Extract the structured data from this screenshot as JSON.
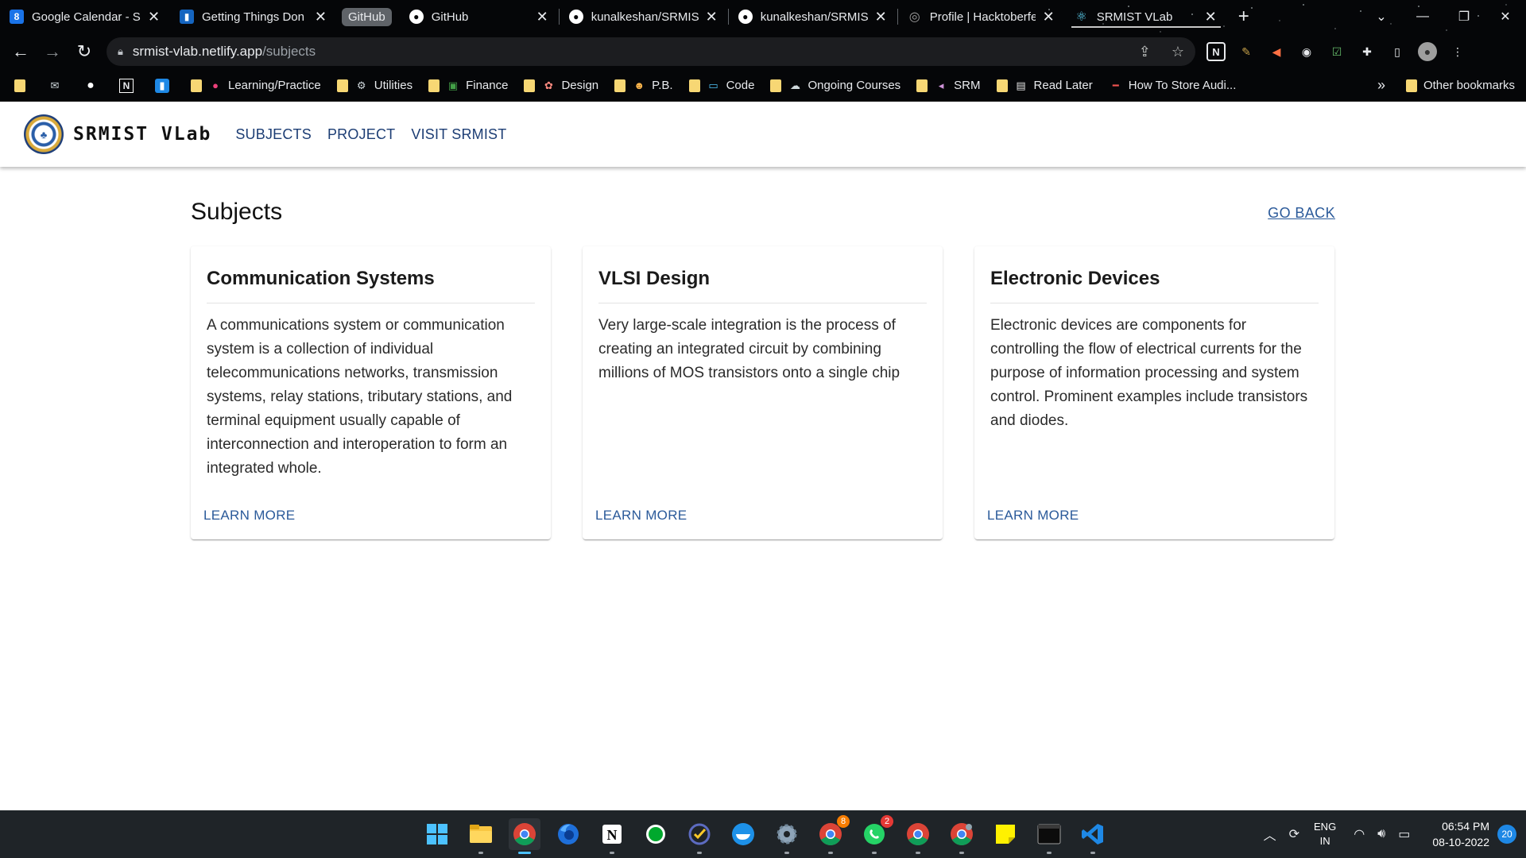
{
  "browser": {
    "tabs": [
      {
        "title": "Google Calendar - S",
        "favicon": "calendar-icon",
        "color": "#1a73e8",
        "glyph": "8"
      },
      {
        "title": "Getting Things Don",
        "favicon": "trello-icon",
        "color": "#1565c0",
        "glyph": "▮▮"
      },
      {
        "title": "GitHub",
        "favicon": "github-icon",
        "color": "#ffffff",
        "glyph": "●"
      },
      {
        "title": "kunalkeshan/SRMIS",
        "favicon": "github-icon",
        "color": "#ffffff",
        "glyph": "●"
      },
      {
        "title": "kunalkeshan/SRMIS",
        "favicon": "github-icon",
        "color": "#ffffff",
        "glyph": "●"
      },
      {
        "title": "Profile | Hacktoberfe",
        "favicon": "hacktoberfest-icon",
        "color": "#9e9e9e",
        "glyph": "◎"
      },
      {
        "title": "SRMIST VLab",
        "favicon": "react-icon",
        "color": "#61dafb",
        "glyph": "⚛"
      }
    ],
    "tab_group_label": "GitHub",
    "address": {
      "host": "srmist-vlab.netlify.app",
      "path": "/subjects"
    },
    "bookmarks": [
      {
        "label": "",
        "icon": "folder-icon"
      },
      {
        "label": "",
        "icon": "mail-icon"
      },
      {
        "label": "",
        "icon": "github-icon"
      },
      {
        "label": "",
        "icon": "notion-icon"
      },
      {
        "label": "",
        "icon": "trello-icon"
      },
      {
        "label": "Learning/Practice",
        "icon": "folder-icon"
      },
      {
        "label": "Utilities",
        "icon": "folder-icon"
      },
      {
        "label": "Finance",
        "icon": "folder-icon"
      },
      {
        "label": "Design",
        "icon": "folder-icon"
      },
      {
        "label": "P.B.",
        "icon": "folder-icon"
      },
      {
        "label": "Code",
        "icon": "folder-icon"
      },
      {
        "label": "Ongoing Courses",
        "icon": "folder-icon"
      },
      {
        "label": "SRM",
        "icon": "folder-icon"
      },
      {
        "label": "Read Later",
        "icon": "folder-icon"
      },
      {
        "label": "How To Store Audi...",
        "icon": "link-icon"
      }
    ],
    "bookmarks_overflow": "»",
    "other_bookmarks": "Other bookmarks"
  },
  "app": {
    "brand": "SRMIST VLab",
    "nav": [
      "SUBJECTS",
      "PROJECT",
      "VISIT SRMIST"
    ]
  },
  "page": {
    "title": "Subjects",
    "go_back": "GO BACK",
    "cards": [
      {
        "title": "Communication Systems",
        "description": "A communications system or communication system is a collection of individual telecommunications networks, transmission systems, relay stations, tributary stations, and terminal equipment usually capable of interconnection and interoperation to form an integrated whole.",
        "action": "LEARN MORE"
      },
      {
        "title": "VLSI Design",
        "description": "Very large-scale integration is the process of creating an integrated circuit by combining millions of MOS transistors onto a single chip",
        "action": "LEARN MORE"
      },
      {
        "title": "Electronic Devices",
        "description": "Electronic devices are components for controlling the flow of electrical currents for the purpose of information processing and system control. Prominent examples include transistors and diodes.",
        "action": "LEARN MORE"
      }
    ]
  },
  "taskbar": {
    "apps": [
      {
        "name": "start-icon",
        "active": false,
        "badge": ""
      },
      {
        "name": "file-explorer-icon",
        "active": false,
        "badge": ""
      },
      {
        "name": "chrome-icon",
        "active": true,
        "badge": ""
      },
      {
        "name": "firefox-icon",
        "active": false,
        "badge": ""
      },
      {
        "name": "notion-icon",
        "active": false,
        "badge": ""
      },
      {
        "name": "evernote-icon",
        "active": false,
        "badge": ""
      },
      {
        "name": "todo-icon",
        "active": false,
        "badge": ""
      },
      {
        "name": "docker-icon",
        "active": false,
        "badge": ""
      },
      {
        "name": "settings-icon",
        "active": false,
        "badge": ""
      },
      {
        "name": "chrome-profile-icon",
        "active": false,
        "badge": "8"
      },
      {
        "name": "whatsapp-icon",
        "active": false,
        "badge": "2"
      },
      {
        "name": "chrome-alt-icon",
        "active": false,
        "badge": ""
      },
      {
        "name": "chrome-dev-icon",
        "active": false,
        "badge": ""
      },
      {
        "name": "sticky-notes-icon",
        "active": false,
        "badge": ""
      },
      {
        "name": "terminal-icon",
        "active": false,
        "badge": ""
      },
      {
        "name": "vscode-icon",
        "active": false,
        "badge": ""
      }
    ],
    "lang_line1": "ENG",
    "lang_line2": "IN",
    "time": "06:54 PM",
    "date": "08-10-2022",
    "notifications": "20"
  }
}
